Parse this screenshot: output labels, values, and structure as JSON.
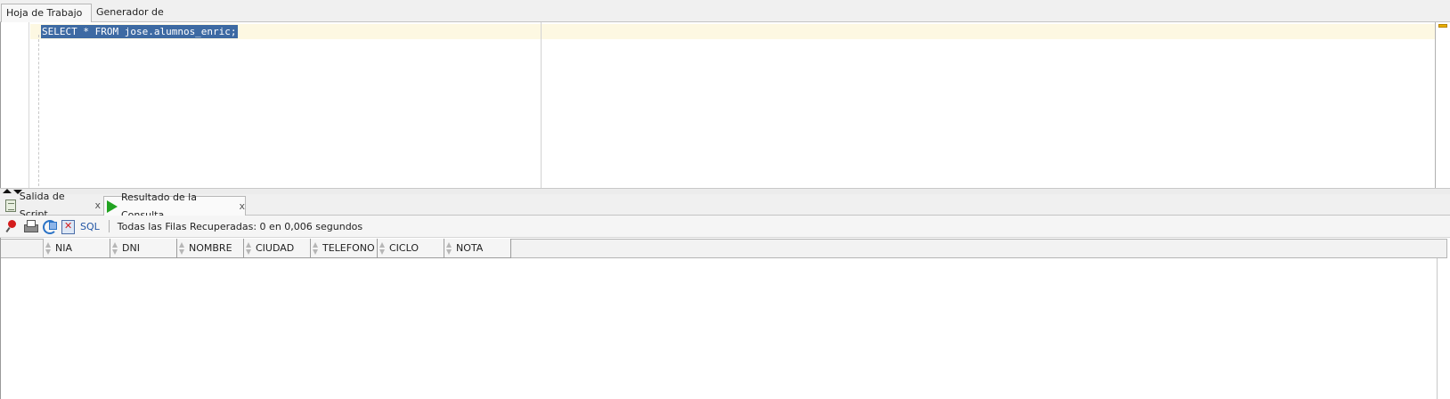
{
  "top_tabs": {
    "worksheet": "Hoja de Trabajo",
    "query_builder": "Generador de Consultas"
  },
  "editor": {
    "sql": "SELECT * FROM jose.alumnos_enric;"
  },
  "bottom_tabs": {
    "script_output": "Salida de Script",
    "query_result": "Resultado de la Consulta",
    "close_glyph": "x"
  },
  "toolbar": {
    "sql_label": "SQL",
    "status": "Todas las Filas Recuperadas: 0 en 0,006 segundos"
  },
  "grid": {
    "columns": [
      "NIA",
      "DNI",
      "NOMBRE",
      "CIUDAD",
      "TELEFONO",
      "CICLO",
      "NOTA"
    ],
    "rows": []
  },
  "colors": {
    "selection": "#3d6aa3",
    "current_line": "#fdf8e2",
    "run_green": "#21a321",
    "link_blue": "#2255a4"
  },
  "icons": [
    "script-output-icon",
    "run-icon",
    "pin-icon",
    "print-icon",
    "refresh-icon",
    "cancel-icon",
    "sort-icon"
  ]
}
